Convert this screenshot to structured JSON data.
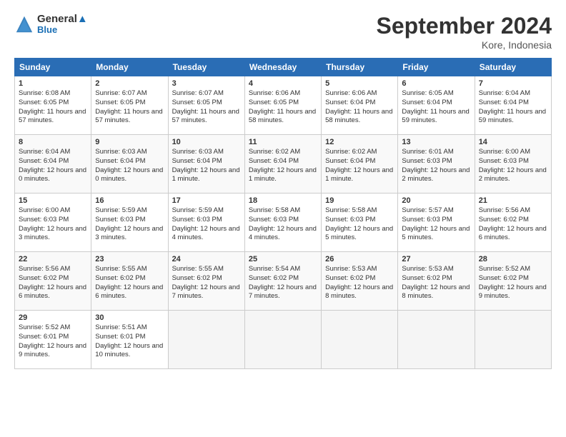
{
  "header": {
    "logo_line1": "General",
    "logo_line2": "Blue",
    "month": "September 2024",
    "location": "Kore, Indonesia"
  },
  "days_of_week": [
    "Sunday",
    "Monday",
    "Tuesday",
    "Wednesday",
    "Thursday",
    "Friday",
    "Saturday"
  ],
  "weeks": [
    [
      {
        "day": "1",
        "sunrise": "6:08 AM",
        "sunset": "6:05 PM",
        "daylight": "11 hours and 57 minutes."
      },
      {
        "day": "2",
        "sunrise": "6:07 AM",
        "sunset": "6:05 PM",
        "daylight": "11 hours and 57 minutes."
      },
      {
        "day": "3",
        "sunrise": "6:07 AM",
        "sunset": "6:05 PM",
        "daylight": "11 hours and 57 minutes."
      },
      {
        "day": "4",
        "sunrise": "6:06 AM",
        "sunset": "6:05 PM",
        "daylight": "11 hours and 58 minutes."
      },
      {
        "day": "5",
        "sunrise": "6:06 AM",
        "sunset": "6:04 PM",
        "daylight": "11 hours and 58 minutes."
      },
      {
        "day": "6",
        "sunrise": "6:05 AM",
        "sunset": "6:04 PM",
        "daylight": "11 hours and 59 minutes."
      },
      {
        "day": "7",
        "sunrise": "6:04 AM",
        "sunset": "6:04 PM",
        "daylight": "11 hours and 59 minutes."
      }
    ],
    [
      {
        "day": "8",
        "sunrise": "6:04 AM",
        "sunset": "6:04 PM",
        "daylight": "12 hours and 0 minutes."
      },
      {
        "day": "9",
        "sunrise": "6:03 AM",
        "sunset": "6:04 PM",
        "daylight": "12 hours and 0 minutes."
      },
      {
        "day": "10",
        "sunrise": "6:03 AM",
        "sunset": "6:04 PM",
        "daylight": "12 hours and 1 minute."
      },
      {
        "day": "11",
        "sunrise": "6:02 AM",
        "sunset": "6:04 PM",
        "daylight": "12 hours and 1 minute."
      },
      {
        "day": "12",
        "sunrise": "6:02 AM",
        "sunset": "6:04 PM",
        "daylight": "12 hours and 1 minute."
      },
      {
        "day": "13",
        "sunrise": "6:01 AM",
        "sunset": "6:03 PM",
        "daylight": "12 hours and 2 minutes."
      },
      {
        "day": "14",
        "sunrise": "6:00 AM",
        "sunset": "6:03 PM",
        "daylight": "12 hours and 2 minutes."
      }
    ],
    [
      {
        "day": "15",
        "sunrise": "6:00 AM",
        "sunset": "6:03 PM",
        "daylight": "12 hours and 3 minutes."
      },
      {
        "day": "16",
        "sunrise": "5:59 AM",
        "sunset": "6:03 PM",
        "daylight": "12 hours and 3 minutes."
      },
      {
        "day": "17",
        "sunrise": "5:59 AM",
        "sunset": "6:03 PM",
        "daylight": "12 hours and 4 minutes."
      },
      {
        "day": "18",
        "sunrise": "5:58 AM",
        "sunset": "6:03 PM",
        "daylight": "12 hours and 4 minutes."
      },
      {
        "day": "19",
        "sunrise": "5:58 AM",
        "sunset": "6:03 PM",
        "daylight": "12 hours and 5 minutes."
      },
      {
        "day": "20",
        "sunrise": "5:57 AM",
        "sunset": "6:03 PM",
        "daylight": "12 hours and 5 minutes."
      },
      {
        "day": "21",
        "sunrise": "5:56 AM",
        "sunset": "6:02 PM",
        "daylight": "12 hours and 6 minutes."
      }
    ],
    [
      {
        "day": "22",
        "sunrise": "5:56 AM",
        "sunset": "6:02 PM",
        "daylight": "12 hours and 6 minutes."
      },
      {
        "day": "23",
        "sunrise": "5:55 AM",
        "sunset": "6:02 PM",
        "daylight": "12 hours and 6 minutes."
      },
      {
        "day": "24",
        "sunrise": "5:55 AM",
        "sunset": "6:02 PM",
        "daylight": "12 hours and 7 minutes."
      },
      {
        "day": "25",
        "sunrise": "5:54 AM",
        "sunset": "6:02 PM",
        "daylight": "12 hours and 7 minutes."
      },
      {
        "day": "26",
        "sunrise": "5:53 AM",
        "sunset": "6:02 PM",
        "daylight": "12 hours and 8 minutes."
      },
      {
        "day": "27",
        "sunrise": "5:53 AM",
        "sunset": "6:02 PM",
        "daylight": "12 hours and 8 minutes."
      },
      {
        "day": "28",
        "sunrise": "5:52 AM",
        "sunset": "6:02 PM",
        "daylight": "12 hours and 9 minutes."
      }
    ],
    [
      {
        "day": "29",
        "sunrise": "5:52 AM",
        "sunset": "6:01 PM",
        "daylight": "12 hours and 9 minutes."
      },
      {
        "day": "30",
        "sunrise": "5:51 AM",
        "sunset": "6:01 PM",
        "daylight": "12 hours and 10 minutes."
      },
      null,
      null,
      null,
      null,
      null
    ]
  ]
}
